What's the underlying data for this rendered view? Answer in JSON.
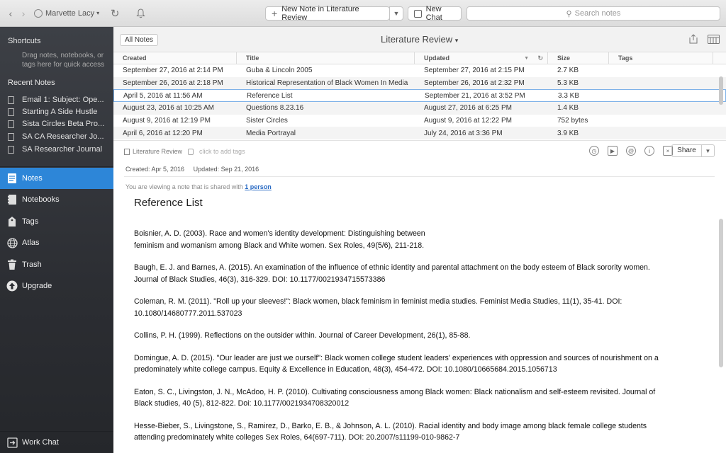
{
  "toolbar": {
    "user_name": "Marvette Lacy",
    "new_note_label": "New Note in Literature Review",
    "new_chat_label": "New Chat",
    "search_placeholder": "Search notes"
  },
  "sidebar": {
    "shortcuts_heading": "Shortcuts",
    "shortcuts_hint": "Drag notes, notebooks, or tags here for quick access",
    "recent_heading": "Recent Notes",
    "recent_notes": [
      "Email 1: Subject: Ope...",
      "Starting A Side Hustle",
      "Sista Circles Beta Pro...",
      "SA CA Researcher Jo...",
      "SA Researcher Journal"
    ],
    "nav": [
      {
        "label": "Notes",
        "icon": "notes-icon"
      },
      {
        "label": "Notebooks",
        "icon": "notebook-icon"
      },
      {
        "label": "Tags",
        "icon": "tag-icon"
      },
      {
        "label": "Atlas",
        "icon": "globe-icon"
      },
      {
        "label": "Trash",
        "icon": "trash-icon"
      },
      {
        "label": "Upgrade",
        "icon": "upgrade-icon"
      }
    ],
    "work_chat_label": "Work Chat"
  },
  "list": {
    "all_notes_label": "All Notes",
    "notebook_title": "Literature Review",
    "columns": [
      "Created",
      "Title",
      "Updated",
      "Size",
      "Tags"
    ],
    "rows": [
      {
        "created": "September 27, 2016 at 2:14 PM",
        "title": "Guba & Lincoln 2005",
        "updated": "September 27, 2016 at 2:15 PM",
        "size": "2.7 KB",
        "tags": ""
      },
      {
        "created": "September 26, 2016 at 2:18 PM",
        "title": "Historical Representation of Black Women In Media",
        "updated": "September 26, 2016 at 2:32 PM",
        "size": "5.3 KB",
        "tags": ""
      },
      {
        "created": "April 5, 2016 at 11:56 AM",
        "title": "Reference List",
        "updated": "September 21, 2016 at 3:52 PM",
        "size": "3.3 KB",
        "tags": ""
      },
      {
        "created": "August 23, 2016 at 10:25 AM",
        "title": "Questions 8.23.16",
        "updated": "August 27, 2016 at 6:25 PM",
        "size": "1.4 KB",
        "tags": ""
      },
      {
        "created": "August 9, 2016 at 12:19 PM",
        "title": "Sister Circles",
        "updated": "August 9, 2016 at 12:22 PM",
        "size": "752 bytes",
        "tags": ""
      },
      {
        "created": "April 6, 2016 at 12:20 PM",
        "title": "Media Portrayal",
        "updated": "July 24, 2016 at 3:36 PM",
        "size": "3.9 KB",
        "tags": ""
      }
    ],
    "selected_index": 2
  },
  "editor": {
    "notebook": "Literature Review",
    "add_tags_placeholder": "click to add tags",
    "share_label": "Share",
    "created": "Created: Apr 5, 2016",
    "updated": "Updated: Sep 21, 2016",
    "shared_prefix": "You are viewing a note that is shared with",
    "shared_link": "1 person",
    "title": "Reference List",
    "references": [
      [
        "Boisnier, A. D. (2003). Race and women's identity development: Distinguishing between",
        "feminism and womanism among Black and White women. Sex Roles, 49(5/6), 211-218."
      ],
      [
        "Baugh, E. J.  and Barnes, A. (2015). An examination of the influence of ethnic identity and parental attachment on the body esteem of Black sorority women.",
        "Journal of Black Studies, 46(3), 316-329. DOI: 10.1177/0021934715573386"
      ],
      [
        "Coleman, R. M. (2011). \"Roll up your sleeves!\": Black women, black feminism in feminist media studies. Feminist Media Studies, 11(1), 35-41. DOI:",
        "10.1080/14680777.2011.537023"
      ],
      [
        "Collins, P. H. (1999). Reflections on the outsider within.  Journal of Career Development, 26(1), 85-88."
      ],
      [
        "Domingue, A. D. (2015). \"Our leader are just we ourself\": Black women college student leaders' experiences with oppression and sources of nourishment on a",
        "predominately white college campus. Equity & Excellence in Education, 48(3), 454-472. DOI: 10.1080/10665684.2015.1056713"
      ],
      [
        "Eaton, S. C., Livingston, J. N., McAdoo, H. P. (2010). Cultivating consciousness among Black women: Black nationalism and self-esteem revisited. Journal of",
        "Black studies, 40 (5), 812-822. Doi: 10.1177/0021934708320012"
      ],
      [
        "Hesse-Bieber, S., Livingstone, S., Ramirez, D., Barko, E. B., & Johnson, A. L. (2010). Racial identity and body image among black female college students",
        "attending predominately white colleges Sex Roles, 64(697-711). DOI: 20.2007/s11199-010-9862-7"
      ]
    ]
  },
  "colors": {
    "accent": "#2d86d8",
    "sidebar": "#2c2e33",
    "link": "#2a6bc4"
  }
}
